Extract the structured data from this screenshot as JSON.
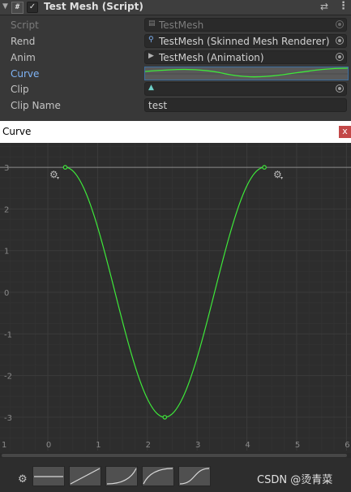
{
  "component": {
    "title": "Test Mesh (Script)",
    "enabled": true,
    "script_icon": "#",
    "checkmark": "✓"
  },
  "properties": [
    {
      "label": "Script",
      "value": "TestMesh",
      "icon": "script-icon",
      "disabled": true
    },
    {
      "label": "Rend",
      "value": "TestMesh (Skinned Mesh Renderer)",
      "icon": "skinned-mesh-renderer-icon"
    },
    {
      "label": "Anim",
      "value": "TestMesh (Animation)",
      "icon": "animation-icon"
    },
    {
      "label": "Curve",
      "value": "",
      "icon": "curve-preview"
    },
    {
      "label": "Clip",
      "value": "",
      "icon": "animation-clip-icon"
    },
    {
      "label": "Clip Name",
      "value": "test"
    }
  ],
  "curve_window": {
    "title": "Curve",
    "close": "x",
    "y_ticks": [
      "3",
      "2",
      "1",
      "0",
      "-1",
      "-2",
      "-3"
    ],
    "x_ticks": [
      "1",
      "0",
      "1",
      "2",
      "3",
      "4",
      "5",
      "6"
    ],
    "presets": [
      "constant",
      "linear",
      "ease-in",
      "ease-out",
      "ease-in-out"
    ]
  },
  "curve_color": "#3ee83a",
  "accent_color": "#3d6fa0",
  "chart_data": {
    "type": "line",
    "x": [
      0.35,
      2.35,
      4.35
    ],
    "y": [
      3,
      -3,
      3
    ],
    "xlim": [
      -1,
      6
    ],
    "ylim": [
      -3.5,
      3.5
    ]
  },
  "watermark": "CSDN @烫青菜"
}
